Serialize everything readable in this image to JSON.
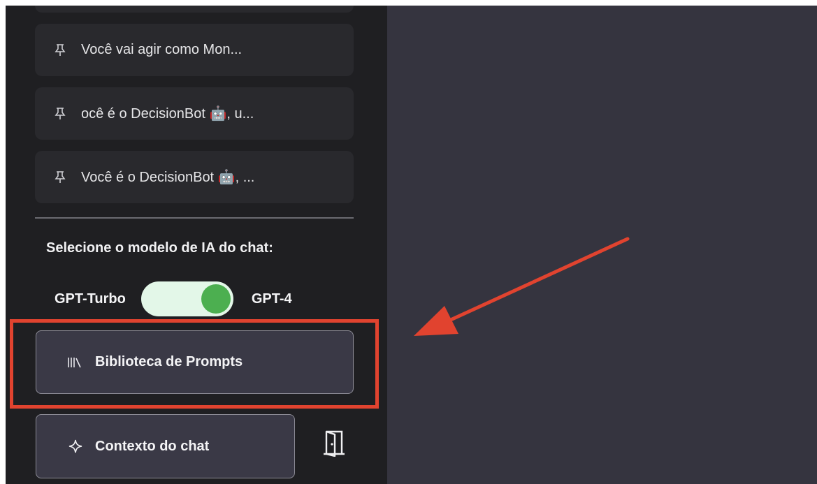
{
  "sidebar": {
    "chat_items": [
      {
        "label": ""
      },
      {
        "label": "Você vai agir como Mon..."
      },
      {
        "label": "ocê é o DecisionBot 🤖, u..."
      },
      {
        "label": "Você é o DecisionBot 🤖, ..."
      }
    ],
    "model_select_label": "Selecione o modelo de IA do chat:",
    "model_toggle": {
      "left_label": "GPT-Turbo",
      "right_label": "GPT-4",
      "selected": "GPT-4"
    },
    "prompt_library_button": {
      "label": "Biblioteca de Prompts",
      "icon": "library-icon"
    },
    "chat_context_button": {
      "label": "Contexto do chat",
      "icon": "sparkle-icon"
    },
    "exit_icon": "door-icon"
  },
  "annotation": {
    "highlight_color": "#e1432f",
    "arrow_color": "#e1432f"
  },
  "colors": {
    "sidebar_bg": "#1f1f22",
    "main_bg": "#35343f",
    "toggle_on": "#4caf50"
  }
}
